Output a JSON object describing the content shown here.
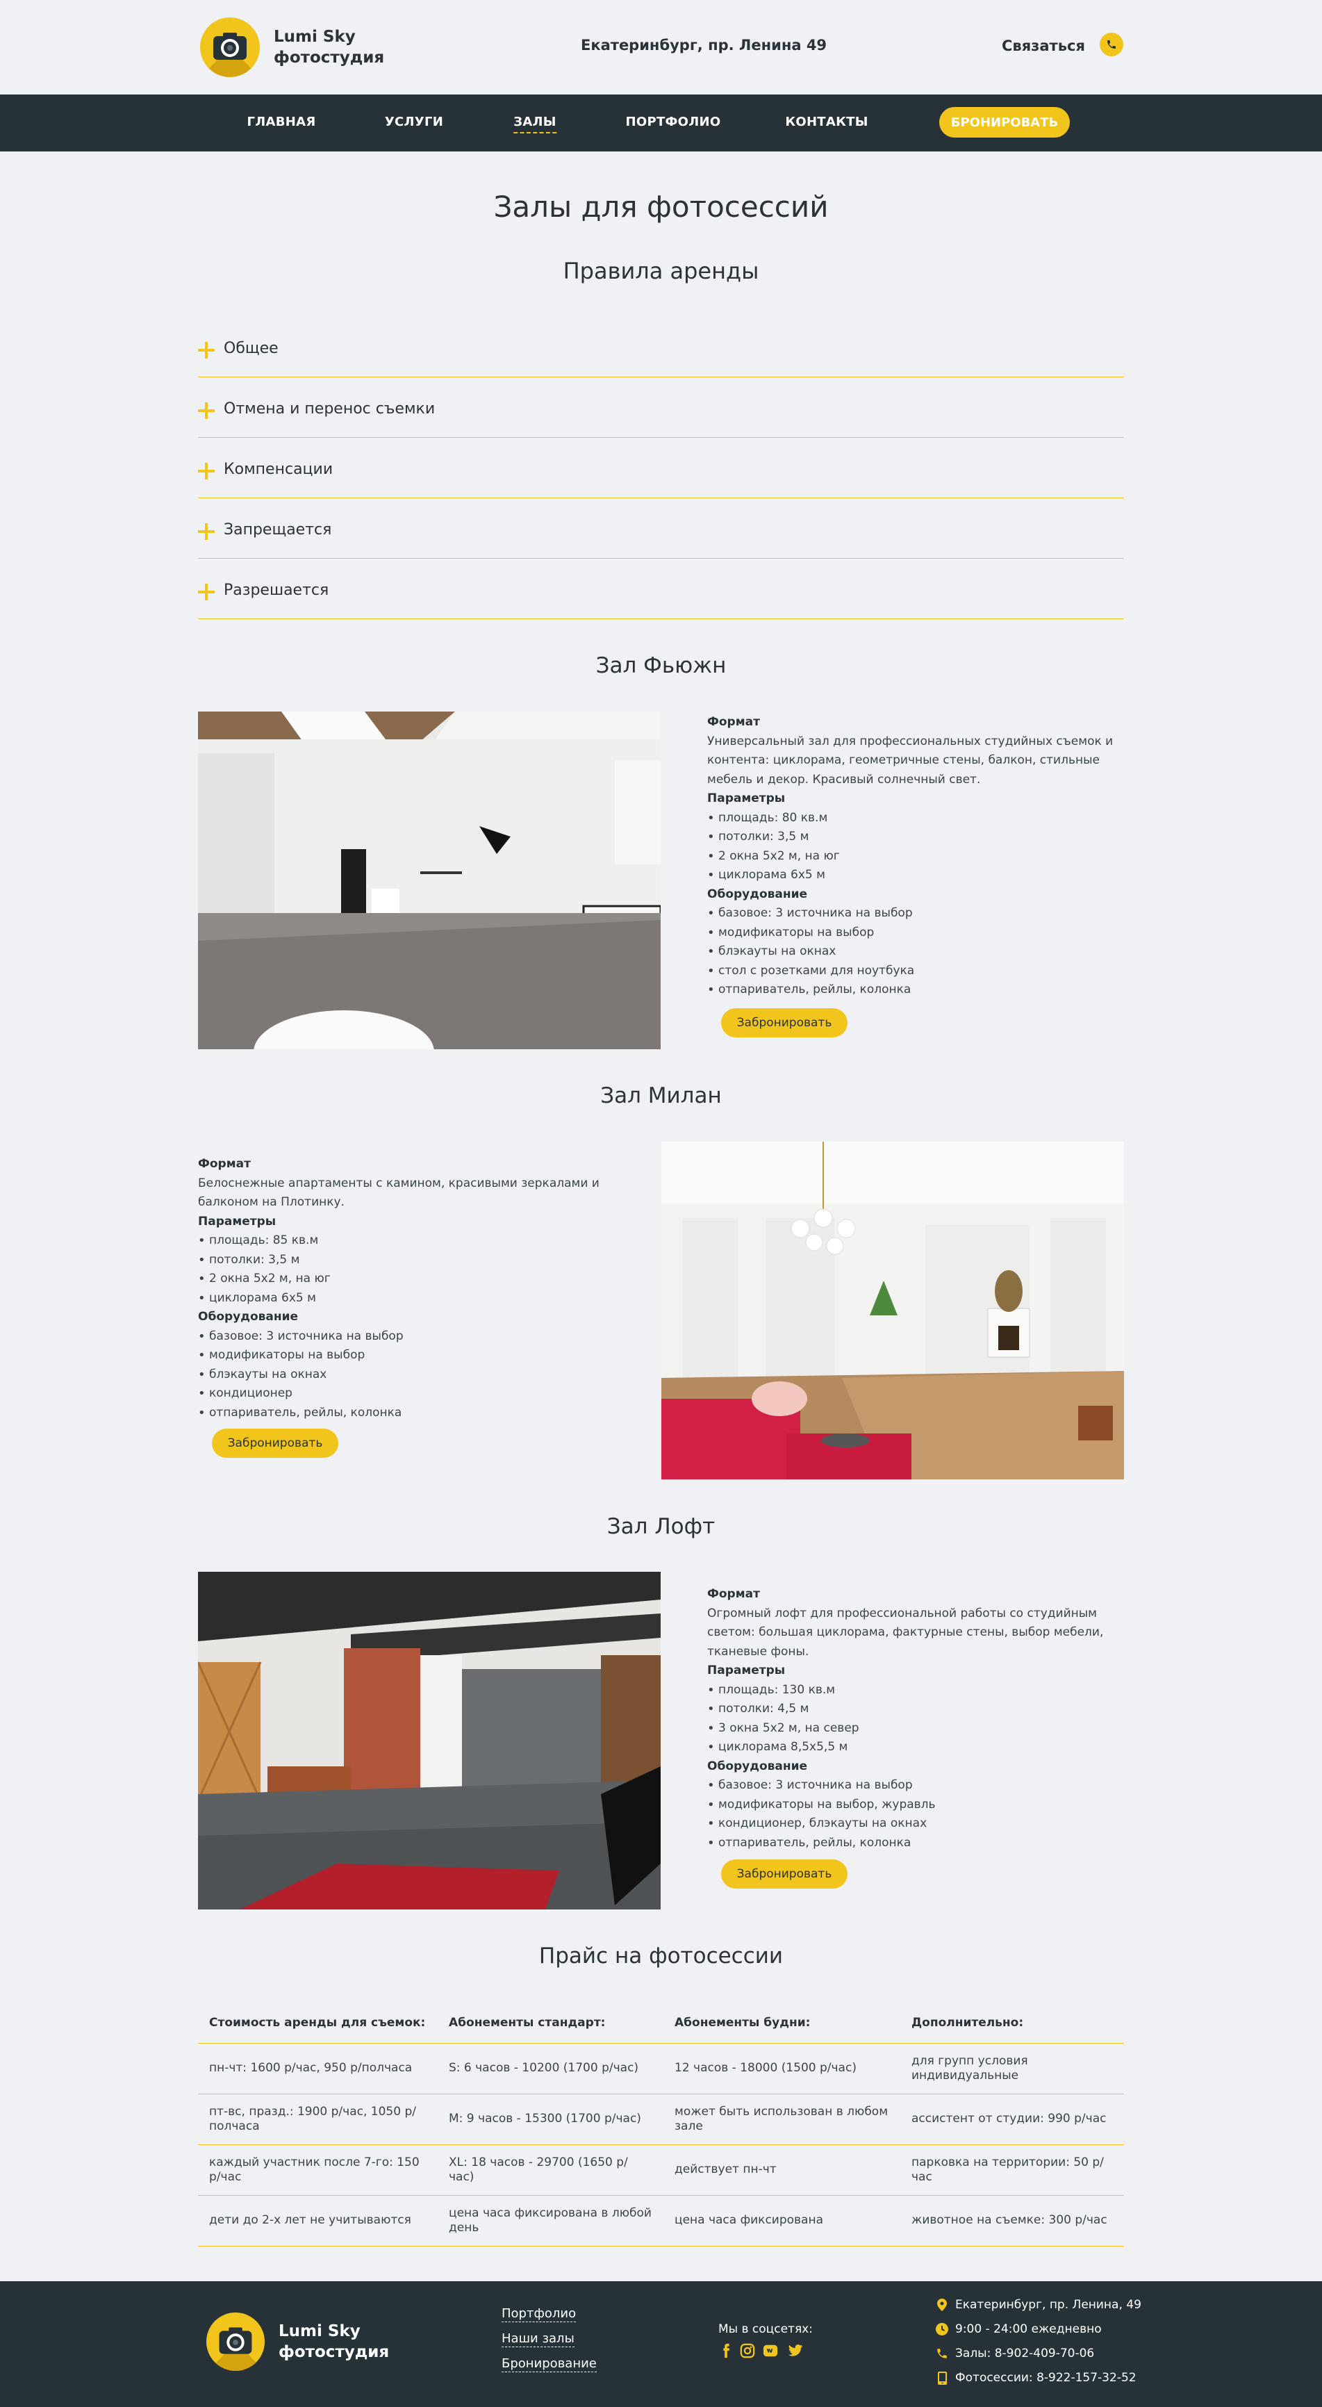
{
  "header": {
    "logo_line1": "Lumi Sky",
    "logo_line2": "фотостудия",
    "address": "Екатеринбург, пр. Ленина 49",
    "contact_label": "Связаться",
    "phone_icon": "phone-icon"
  },
  "nav": {
    "items": [
      {
        "label": "ГЛАВНАЯ"
      },
      {
        "label": "УСЛУГИ"
      },
      {
        "label": "ЗАЛЫ"
      },
      {
        "label": "ПОРТФОЛИО"
      },
      {
        "label": "КОНТАКТЫ"
      }
    ],
    "active": "ЗАЛЫ",
    "book_label": "БРОНИРОВАТЬ"
  },
  "page": {
    "title": "Залы для фотосессий",
    "rules_title": "Правила аренды"
  },
  "rules": [
    "Общее",
    "Отмена и перенос съемки",
    "Компенсации",
    "Запрещается",
    "Разрешается"
  ],
  "halls": [
    {
      "title": "Зал Фьюжн",
      "format_label": "Формат",
      "format_text": "Универсальный зал для профессиональных студийных съемок и контента: циклорама, геометричные стены, балкон, стильные мебель и декор. Красивый солнечный свет.",
      "params_label": "Параметры",
      "params": [
        "площадь: 80 кв.м",
        "потолки: 3,5 м",
        "2 окна 5x2 м, на юг",
        "циклорама 6x5 м"
      ],
      "equipment_label": "Оборудование",
      "equipment": [
        "базовое: 3 источника на выбор",
        "модификаторы на выбор",
        "блэкауты на окнах",
        "стол с розетками для ноутбука",
        "отпариватель, рейлы, колонка"
      ],
      "button": "Забронировать"
    },
    {
      "title": "Зал Милан",
      "format_label": "Формат",
      "format_text": "Белоснежные апартаменты с камином, красивыми зеркалами и балконом на Плотинку.",
      "params_label": "Параметры",
      "params": [
        "площадь: 85 кв.м",
        "потолки: 3,5 м",
        "2 окна 5x2 м, на юг",
        "циклорама 6x5 м"
      ],
      "equipment_label": "Оборудование",
      "equipment": [
        "базовое: 3 источника на выбор",
        "модификаторы на выбор",
        "блэкауты на окнах",
        "кондиционер",
        "отпариватель, рейлы, колонка"
      ],
      "button": "Забронировать"
    },
    {
      "title": "Зал Лофт",
      "format_label": "Формат",
      "format_text": "Огромный лофт для профессиональной работы со студийным светом: большая циклорама, фактурные стены, выбор мебели, тканевые фоны.",
      "params_label": "Параметры",
      "params": [
        "площадь: 130 кв.м",
        "потолки: 4,5 м",
        "3 окна 5x2 м, на север",
        "циклорама 8,5x5,5 м"
      ],
      "equipment_label": "Оборудование",
      "equipment": [
        "базовое: 3 источника на выбор",
        "модификаторы на выбор, журавль",
        "кондиционер, блэкауты на окнах",
        "отпариватель, рейлы, колонка"
      ],
      "button": "Забронировать"
    }
  ],
  "pricing": {
    "title": "Прайс на фотосессии",
    "headers": [
      "Стоимость аренды для съемок:",
      "Абонементы стандарт:",
      "Абонементы будни:",
      "Дополнительно:"
    ],
    "rows": [
      [
        "пн-чт: 1600 р/час, 950 р/полчаса",
        "S: 6 часов - 10200 (1700 р/час)",
        "12 часов - 18000 (1500 р/час)",
        "для групп условия индивидуальные"
      ],
      [
        "пт-вс, празд.: 1900 р/час, 1050 р/полчаса",
        "M: 9 часов - 15300 (1700 р/час)",
        "может быть использован в любом зале",
        "ассистент от студии: 990 р/час"
      ],
      [
        "каждый участник после 7-го: 150 р/час",
        "XL: 18 часов - 29700 (1650 р/час)",
        "действует пн-чт",
        "парковка на территории: 50 р/час"
      ],
      [
        "дети до 2-х лет не учитываются",
        "цена часа фиксирована в любой день",
        "цена часа фиксирована",
        "животное на съемке: 300 р/час"
      ]
    ]
  },
  "footer": {
    "logo_line1": "Lumi Sky",
    "logo_line2": "фотостудия",
    "links": [
      "Портфолио",
      "Наши залы",
      "Бронирование"
    ],
    "social_title": "Мы в соцсетях:",
    "social_icons": [
      "facebook-icon",
      "instagram-icon",
      "vk-icon",
      "twitter-icon"
    ],
    "contacts": [
      {
        "icon": "map-pin-icon",
        "text": "Екатеринбург, пр. Ленина, 49"
      },
      {
        "icon": "clock-icon",
        "text": "9:00 - 24:00 ежедневно"
      },
      {
        "icon": "phone-icon",
        "text": "Залы: 8-902-409-70-06"
      },
      {
        "icon": "mobile-icon",
        "text": "Фотосессии: 8-922-157-32-52"
      }
    ]
  },
  "colors": {
    "accent": "#f1c51c",
    "dark": "#263238",
    "background": "#f0f1f5",
    "text": "#2b3338"
  }
}
